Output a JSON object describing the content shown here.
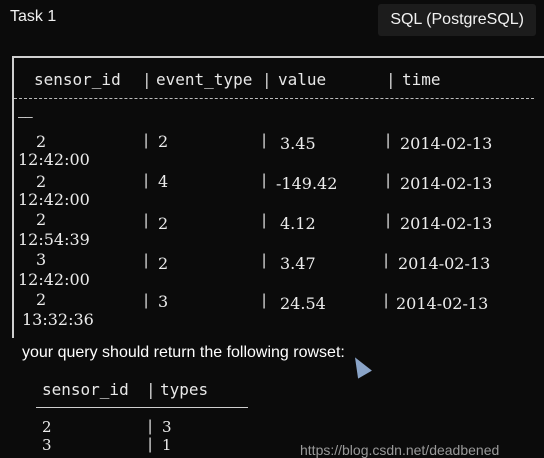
{
  "header": {
    "task_title": "Task 1",
    "language": "SQL (PostgreSQL)"
  },
  "source_table": {
    "columns": [
      "sensor_id",
      "event_type",
      "value",
      "time"
    ],
    "rows": [
      {
        "sensor_id": "2",
        "event_type": "2",
        "value": "3.45",
        "date": "2014-02-13",
        "clock": "12:42:00"
      },
      {
        "sensor_id": "2",
        "event_type": "4",
        "value": "-149.42",
        "date": "2014-02-13",
        "clock": "12:42:00"
      },
      {
        "sensor_id": "2",
        "event_type": "2",
        "value": "4.12",
        "date": "2014-02-13",
        "clock": "12:54:39"
      },
      {
        "sensor_id": "3",
        "event_type": "2",
        "value": "3.47",
        "date": "2014-02-13",
        "clock": "12:42:00"
      },
      {
        "sensor_id": "2",
        "event_type": "3",
        "value": "24.54",
        "date": "2014-02-13",
        "clock": "13:32:36"
      }
    ]
  },
  "instruction": "your query should return the following rowset:",
  "result_table": {
    "columns": [
      "sensor_id",
      "types"
    ],
    "rows": [
      {
        "sensor_id": "2",
        "types": "3"
      },
      {
        "sensor_id": "3",
        "types": "1"
      }
    ]
  },
  "watermark": "https://blog.csdn.net/deadbened"
}
